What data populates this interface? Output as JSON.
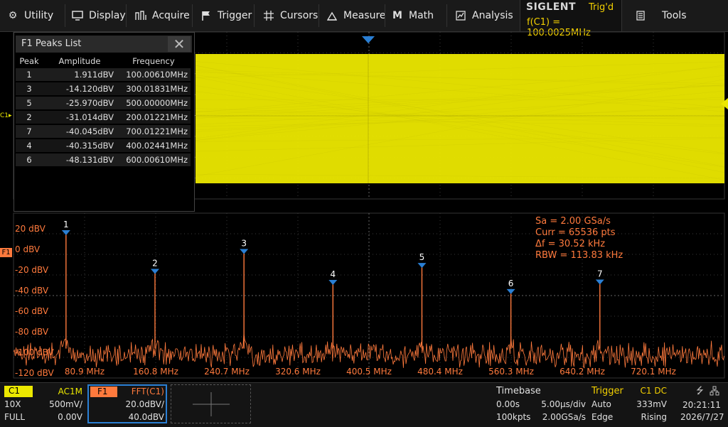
{
  "menu": {
    "items": [
      {
        "label": "Utility",
        "icon": "gear-icon"
      },
      {
        "label": "Display",
        "icon": "monitor-icon"
      },
      {
        "label": "Acquire",
        "icon": "acquire-icon"
      },
      {
        "label": "Trigger",
        "icon": "flag-icon"
      },
      {
        "label": "Cursors",
        "icon": "crosshair-icon"
      },
      {
        "label": "Measure",
        "icon": "measure-icon"
      },
      {
        "label": "Math",
        "icon": "math-icon"
      },
      {
        "label": "Analysis",
        "icon": "analysis-icon"
      },
      {
        "label": "Tools",
        "icon": "tools-icon"
      }
    ],
    "brand": "SIGLENT",
    "trig_state": "Trig'd",
    "freq_readout": "f(C1) = 100.0025MHz"
  },
  "peaks_panel": {
    "title": "F1 Peaks List",
    "columns": [
      "Peak",
      "Amplitude",
      "Frequency"
    ],
    "rows": [
      [
        "1",
        "1.911dBV",
        "100.00610MHz"
      ],
      [
        "3",
        "-14.120dBV",
        "300.01831MHz"
      ],
      [
        "5",
        "-25.970dBV",
        "500.00000MHz"
      ],
      [
        "2",
        "-31.014dBV",
        "200.01221MHz"
      ],
      [
        "7",
        "-40.045dBV",
        "700.01221MHz"
      ],
      [
        "4",
        "-40.315dBV",
        "400.02441MHz"
      ],
      [
        "6",
        "-48.131dBV",
        "600.00610MHz"
      ]
    ]
  },
  "channel_marker": "C1",
  "fft_marker": "F1",
  "fft_info": [
    "Sa =  2.00 GSa/s",
    "Curr = 65536 pts",
    "Δf =  30.52 kHz",
    "RBW =  113.83 kHz"
  ],
  "chart_data": {
    "type": "line",
    "title": "",
    "y_tick_labels": [
      "20 dBV",
      "0 dBV",
      "-20 dBV",
      "-40 dBV",
      "-60 dBV",
      "-80 dBV",
      "-100 dBV",
      "-120 dBV"
    ],
    "x_tick_labels": [
      "80.9 MHz",
      "160.8 MHz",
      "240.7 MHz",
      "320.6 MHz",
      "400.5 MHz",
      "480.4 MHz",
      "560.3 MHz",
      "640.2 MHz",
      "720.1 MHz"
    ],
    "ylim": [
      -120,
      20
    ],
    "xlim": [
      41,
      840
    ],
    "peaks": [
      {
        "label": "1",
        "freq_mhz": 100.0,
        "dbv": 1.911
      },
      {
        "label": "2",
        "freq_mhz": 200.0,
        "dbv": -31.014
      },
      {
        "label": "3",
        "freq_mhz": 300.0,
        "dbv": -14.12
      },
      {
        "label": "4",
        "freq_mhz": 400.0,
        "dbv": -40.315
      },
      {
        "label": "5",
        "freq_mhz": 500.0,
        "dbv": -25.97
      },
      {
        "label": "6",
        "freq_mhz": 600.0,
        "dbv": -48.131
      },
      {
        "label": "7",
        "freq_mhz": 700.0,
        "dbv": -40.045
      }
    ],
    "noise_floor_dbv": -95
  },
  "status": {
    "c1": {
      "name": "C1",
      "coupling": "AC1M",
      "probe": "10X",
      "scale": "500mV/",
      "bw": "FULL",
      "offset": "0.00V"
    },
    "f1": {
      "name": "F1",
      "source": "FFT(C1)",
      "scale": "20.0dBV/",
      "ref": "40.0dBV"
    },
    "timebase": {
      "title": "Timebase",
      "delay": "0.00s",
      "scale": "5.00μs/div",
      "points": "100kpts",
      "rate": "2.00GSa/s"
    },
    "trigger": {
      "title": "Trigger",
      "source": "C1 DC",
      "mode": "Auto",
      "level": "333mV",
      "type": "Edge",
      "slope": "Rising"
    },
    "clock": {
      "time": "20:21:11",
      "date": "2026/7/27"
    }
  },
  "colors": {
    "ch1": "#f3f000",
    "fft": "#ff7a3d",
    "accent": "#2a7fd4"
  }
}
